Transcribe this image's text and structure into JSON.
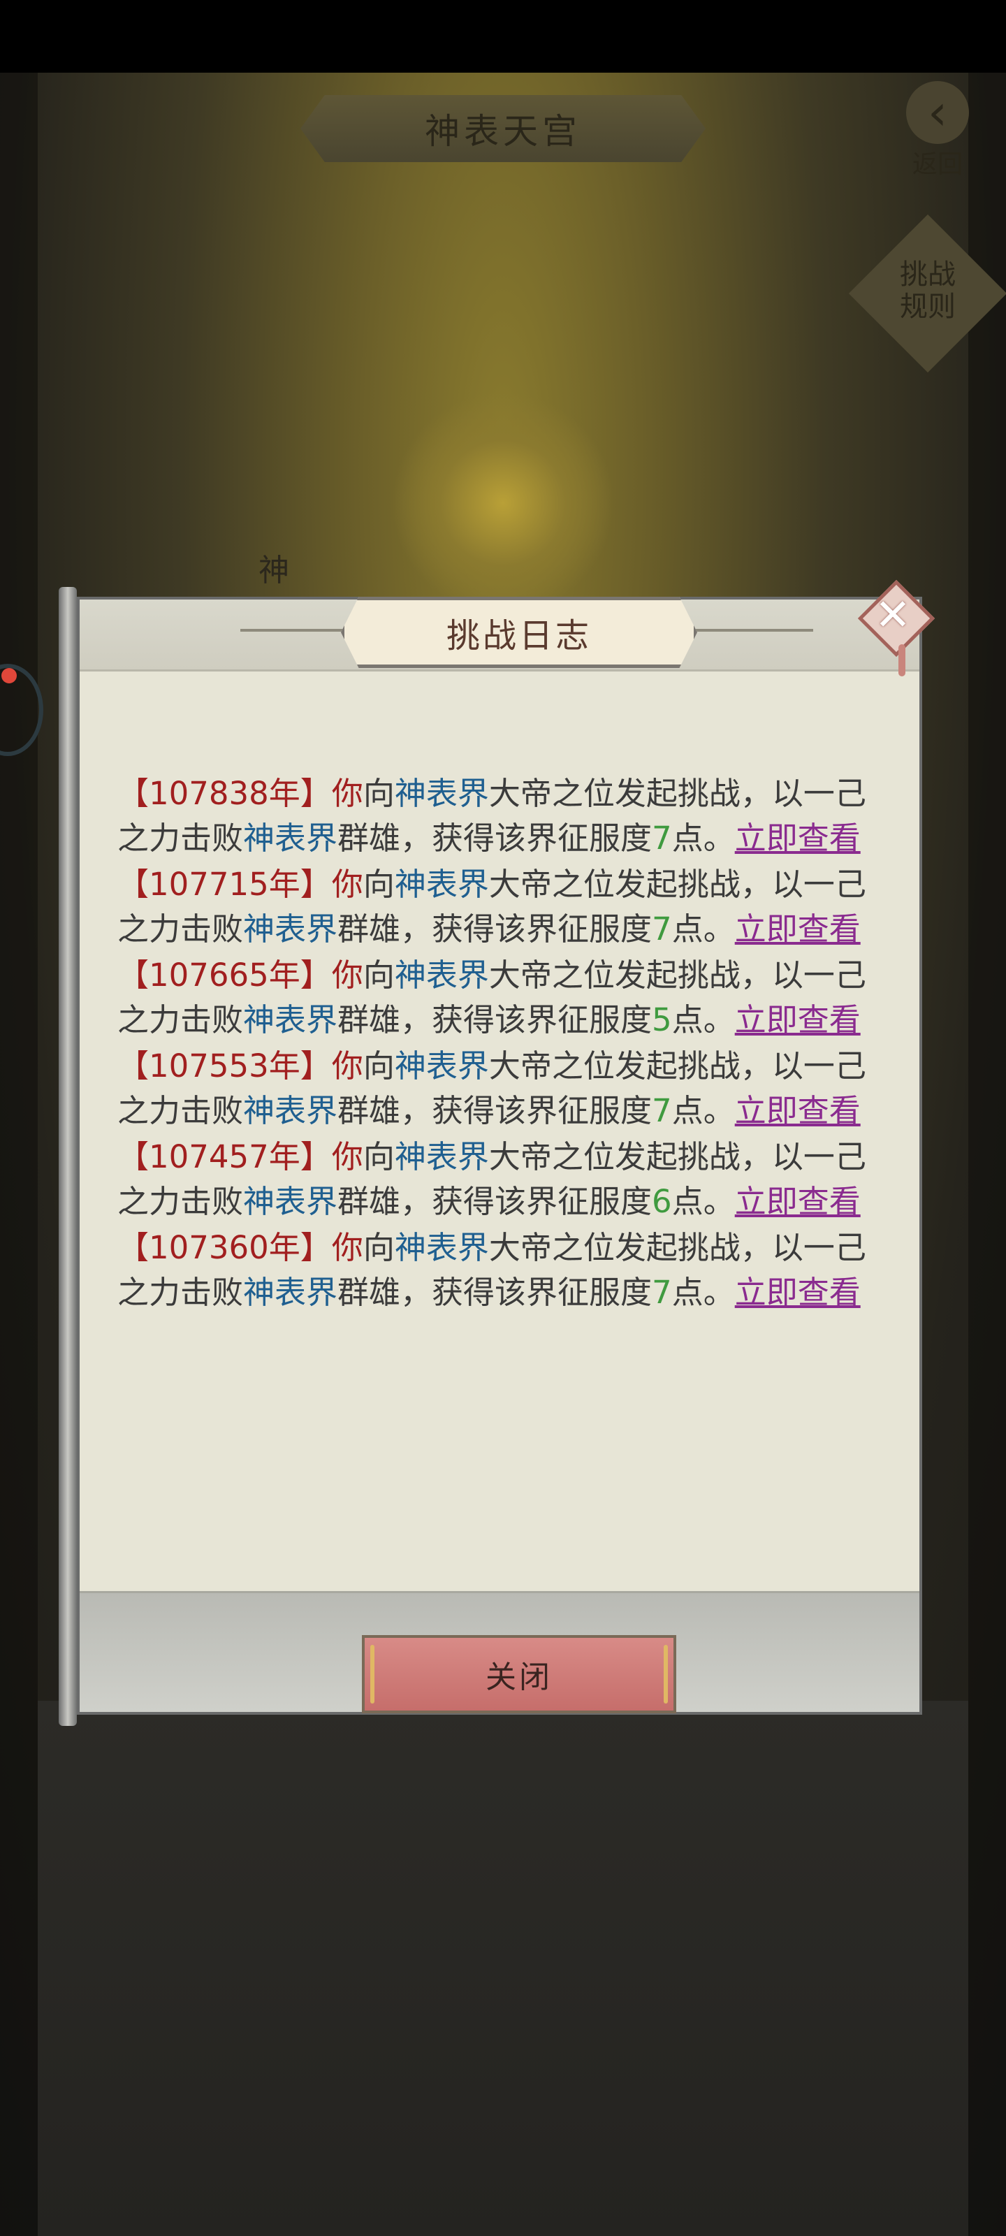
{
  "header": {
    "title": "神表天宫",
    "back_label": "返回",
    "rules_label_line1": "挑战",
    "rules_label_line2": "规则",
    "side_char": "神"
  },
  "dialog": {
    "title": "挑战日志",
    "close_button_label": "关闭",
    "entries": [
      {
        "year": "【107838年】",
        "you": "你",
        "to": "向",
        "realm": "神表界",
        "mid1": "大帝之位发起挑战，以一己之力击败",
        "realm2": "神表界",
        "mid2": "群雄，获得该界征服度",
        "points": "7",
        "tail": "点。",
        "link": "立即查看"
      },
      {
        "year": "【107715年】",
        "you": "你",
        "to": "向",
        "realm": "神表界",
        "mid1": "大帝之位发起挑战，以一己之力击败",
        "realm2": "神表界",
        "mid2": "群雄，获得该界征服度",
        "points": "7",
        "tail": "点。",
        "link": "立即查看"
      },
      {
        "year": "【107665年】",
        "you": "你",
        "to": "向",
        "realm": "神表界",
        "mid1": "大帝之位发起挑战，以一己之力击败",
        "realm2": "神表界",
        "mid2": "群雄，获得该界征服度",
        "points": "5",
        "tail": "点。",
        "link": "立即查看"
      },
      {
        "year": "【107553年】",
        "you": "你",
        "to": "向",
        "realm": "神表界",
        "mid1": "大帝之位发起挑战，以一己之力击败",
        "realm2": "神表界",
        "mid2": "群雄，获得该界征服度",
        "points": "7",
        "tail": "点。",
        "link": "立即查看"
      },
      {
        "year": "【107457年】",
        "you": "你",
        "to": "向",
        "realm": "神表界",
        "mid1": "大帝之位发起挑战，以一己之力击败",
        "realm2": "神表界",
        "mid2": "群雄，获得该界征服度",
        "points": "6",
        "tail": "点。",
        "link": "立即查看"
      },
      {
        "year": "【107360年】",
        "you": "你",
        "to": "向",
        "realm": "神表界",
        "mid1": "大帝之位发起挑战，以一己之力击败",
        "realm2": "神表界",
        "mid2": "群雄，获得该界征服度",
        "points": "7",
        "tail": "点。",
        "link": "立即查看"
      }
    ]
  },
  "colors": {
    "year": "#a11f1f",
    "realm": "#1f5f90",
    "points": "#3f9a3f",
    "link": "#8a2b8f",
    "close_button": "#d07c78"
  }
}
